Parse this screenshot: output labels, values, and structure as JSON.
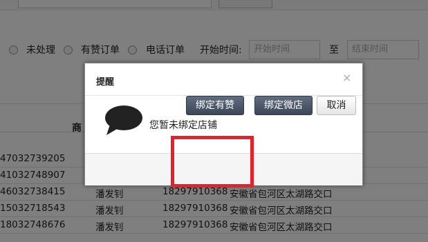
{
  "filters": {
    "options": [
      "未处理",
      "有赞订单",
      "电话订单"
    ],
    "start_label": "开始时间:",
    "start_placeholder": "开始时间",
    "to_label": "至",
    "end_placeholder": "结束时间"
  },
  "table": {
    "header_partial": "商",
    "rows": [
      {
        "id": "47032739205",
        "name": "",
        "phone": "",
        "address": ""
      },
      {
        "id": "41032748907",
        "name": "",
        "phone": "",
        "address": ""
      },
      {
        "id": "46032738415",
        "name": "潘发钊",
        "phone": "18297910368",
        "address": "安徽省包河区太湖路交口"
      },
      {
        "id": "15032718543",
        "name": "潘发钊",
        "phone": "18297910368",
        "address": "安徽省包河区太湖路交口"
      },
      {
        "id": "18032748676",
        "name": "潘发钊",
        "phone": "18297910368",
        "address": "安徽省包河区太湖路交口"
      }
    ]
  },
  "dialog": {
    "title": "提醒",
    "close": "×",
    "icon": "speech-bubble-icon",
    "message": "您暂未绑定店铺",
    "buttons": {
      "bind_youzan": "绑定有赞",
      "bind_weidian": "绑定微店",
      "cancel": "取消"
    }
  },
  "colors": {
    "highlight": "#e8202a",
    "primary_button": "#4a5568"
  }
}
